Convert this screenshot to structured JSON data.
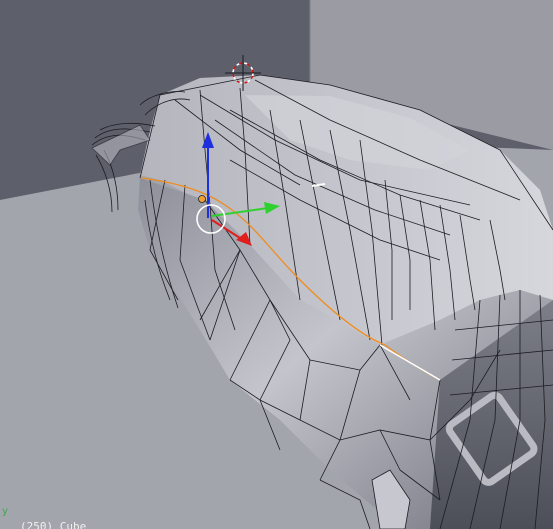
{
  "viewport": {
    "object_label": "(250) Cube",
    "axis_hint": "y"
  },
  "colors": {
    "backdrop_upper_left": "#5d5f6b",
    "backdrop_right": "#9a9ba3",
    "floor": "#a3a5ad",
    "mesh_light": "#c9cad1",
    "mesh_dark": "#6f717b",
    "wire": "#1c1c22",
    "selected_edge": "#f08c1e",
    "gizmo_x": "#e01e1e",
    "gizmo_y": "#2fd12f",
    "gizmo_z": "#1e2fe0",
    "origin_dot": "#f0a030"
  },
  "icons": {
    "cursor": "3d-cursor-icon",
    "transform_gizmo": "translate-gizmo-icon"
  }
}
